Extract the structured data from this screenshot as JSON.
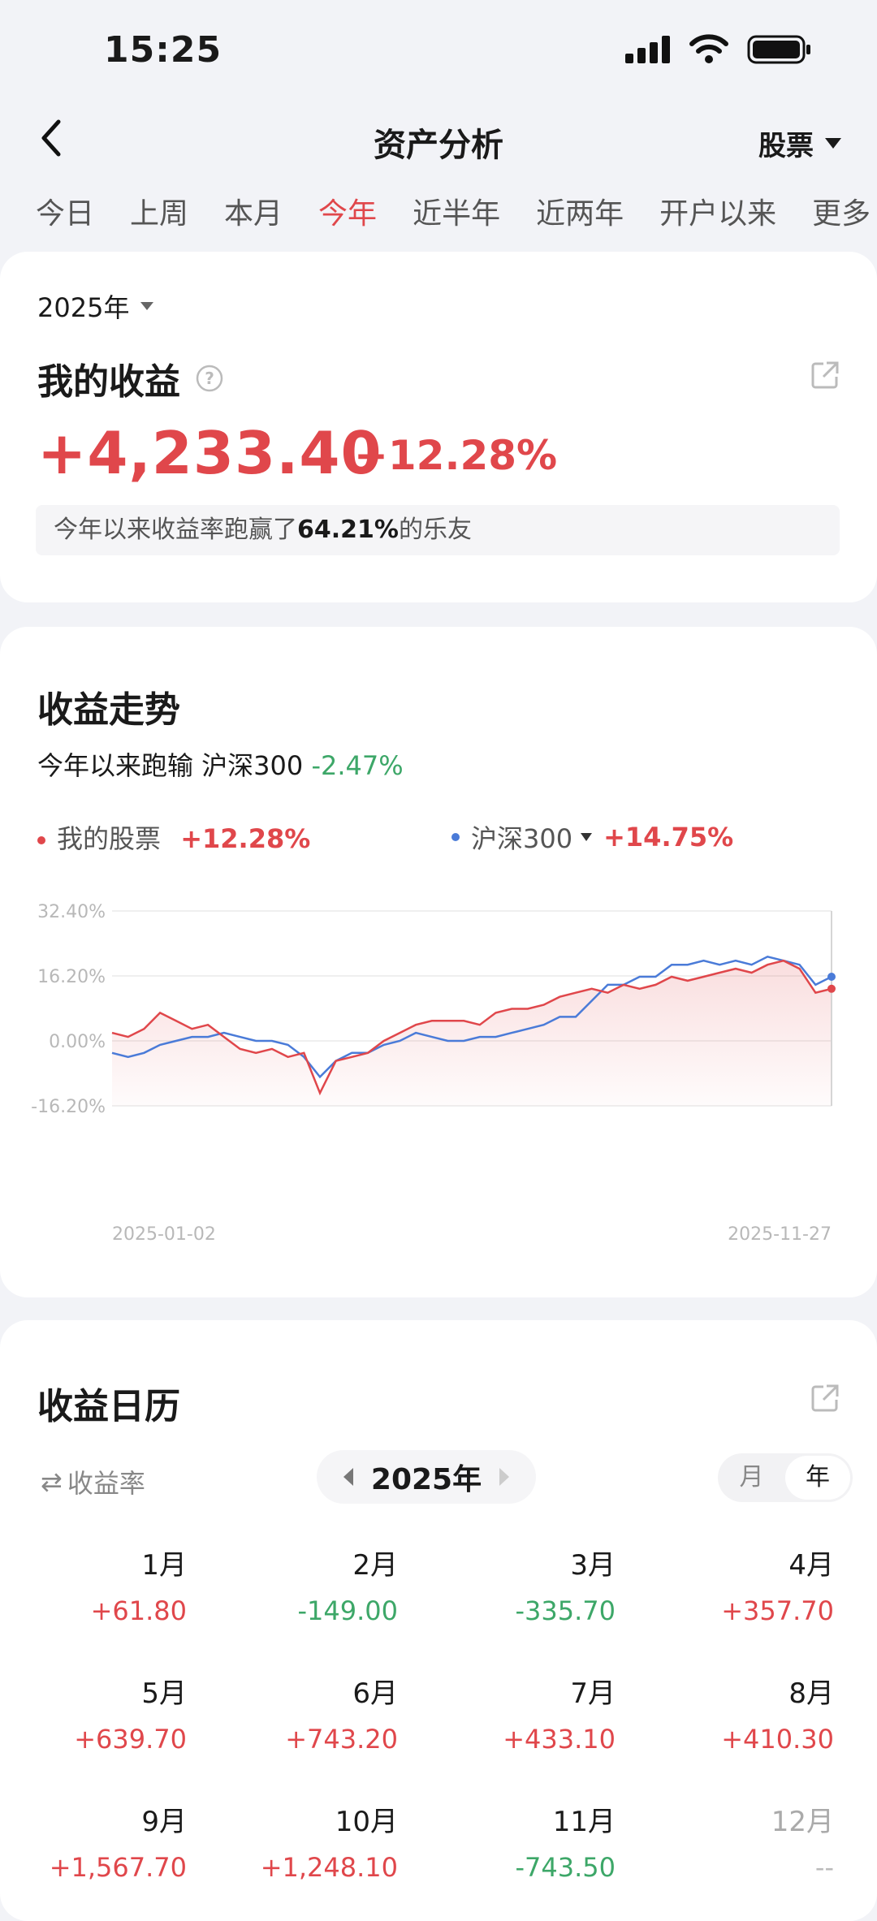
{
  "status": {
    "time": "15:25"
  },
  "nav": {
    "title": "资产分析",
    "dropdown": "股票"
  },
  "tabs": [
    "今日",
    "上周",
    "本月",
    "今年",
    "近半年",
    "近两年",
    "开户以来",
    "更多"
  ],
  "summary": {
    "year_selector": "2025年",
    "title": "我的收益",
    "amount": "+4,233.40",
    "percent": "+12.28%",
    "beat_prefix": "今年以来收益率跑赢了",
    "beat_value": "64.21%",
    "beat_suffix": "的乐友"
  },
  "trend": {
    "title": "收益走势",
    "compare_prefix": "今年以来跑输 沪深300",
    "compare_value": "-2.47%",
    "legend": [
      {
        "name": "我的股票",
        "value": "+12.28%",
        "color": "#E0474B"
      },
      {
        "name": "沪深300",
        "value": "+14.75%",
        "color": "#4A7BD8"
      }
    ]
  },
  "chart_data": {
    "type": "line",
    "x_start": "2025-01-02",
    "x_end": "2025-11-27",
    "yticks": [
      "32.40%",
      "16.20%",
      "0.00%",
      "-16.20%"
    ],
    "ylim": [
      -16.2,
      32.4
    ],
    "series": [
      {
        "name": "我的股票",
        "color": "#E0474B",
        "values": [
          2,
          1,
          3,
          7,
          5,
          3,
          4,
          1,
          -2,
          -3,
          -2,
          -4,
          -3,
          -13,
          -5,
          -4,
          -3,
          0,
          2,
          4,
          5,
          5,
          5,
          4,
          7,
          8,
          8,
          9,
          11,
          12,
          13,
          12,
          14,
          13,
          14,
          16,
          15,
          16,
          17,
          18,
          17,
          19,
          20,
          18,
          12,
          13
        ]
      },
      {
        "name": "沪深300",
        "color": "#4A7BD8",
        "values": [
          -3,
          -4,
          -3,
          -1,
          0,
          1,
          1,
          2,
          1,
          0,
          0,
          -1,
          -4,
          -9,
          -5,
          -3,
          -3,
          -1,
          0,
          2,
          1,
          0,
          0,
          1,
          1,
          2,
          3,
          4,
          6,
          6,
          10,
          14,
          14,
          16,
          16,
          19,
          19,
          20,
          19,
          20,
          19,
          21,
          20,
          19,
          14,
          16
        ]
      }
    ]
  },
  "calendar": {
    "title": "收益日历",
    "mode_label": "收益率",
    "year": "2025年",
    "toggle": [
      "月",
      "年"
    ],
    "months": [
      {
        "name": "1月",
        "value": "+61.80",
        "kind": "pos"
      },
      {
        "name": "2月",
        "value": "-149.00",
        "kind": "neg"
      },
      {
        "name": "3月",
        "value": "-335.70",
        "kind": "neg"
      },
      {
        "name": "4月",
        "value": "+357.70",
        "kind": "pos"
      },
      {
        "name": "5月",
        "value": "+639.70",
        "kind": "pos"
      },
      {
        "name": "6月",
        "value": "+743.20",
        "kind": "pos"
      },
      {
        "name": "7月",
        "value": "+433.10",
        "kind": "pos"
      },
      {
        "name": "8月",
        "value": "+410.30",
        "kind": "pos"
      },
      {
        "name": "9月",
        "value": "+1,567.70",
        "kind": "pos"
      },
      {
        "name": "10月",
        "value": "+1,248.10",
        "kind": "pos"
      },
      {
        "name": "11月",
        "value": "-743.50",
        "kind": "neg"
      },
      {
        "name": "12月",
        "value": "--",
        "kind": "none"
      }
    ]
  }
}
